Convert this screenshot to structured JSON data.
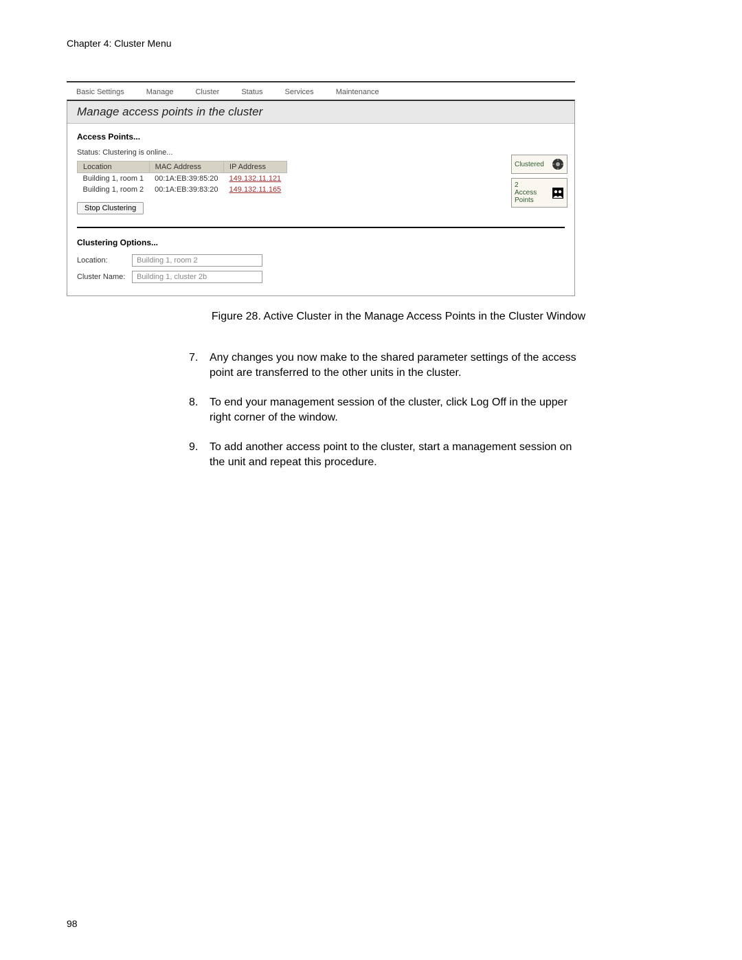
{
  "page_header": "Chapter 4: Cluster Menu",
  "tabs": {
    "basic_settings": "Basic Settings",
    "manage": "Manage",
    "cluster": "Cluster",
    "status": "Status",
    "services": "Services",
    "maintenance": "Maintenance"
  },
  "panel": {
    "title": "Manage access points in the cluster",
    "access_points_heading": "Access Points...",
    "status_text": "Status: Clustering is online...",
    "table": {
      "headers": {
        "location": "Location",
        "mac": "MAC Address",
        "ip": "IP Address"
      },
      "rows": [
        {
          "location": "Building 1, room 1",
          "mac": "00:1A:EB:39:85:20",
          "ip": "149.132.11.121"
        },
        {
          "location": "Building 1, room 2",
          "mac": "00:1A:EB:39:83:20",
          "ip": "149.132.11.165"
        }
      ]
    },
    "stop_button": "Stop Clustering",
    "clustering_options_heading": "Clustering Options...",
    "location_label": "Location:",
    "location_value": "Building 1, room 2",
    "cluster_name_label": "Cluster Name:",
    "cluster_name_value": "Building 1, cluster 2b",
    "side": {
      "clustered_label": "Clustered",
      "ap_count": "2",
      "ap_label_line1": "Access",
      "ap_label_line2": "Points"
    }
  },
  "figure_caption": "Figure 28. Active Cluster in the Manage Access Points in the Cluster Window",
  "instructions": [
    {
      "num": "7.",
      "text": "Any changes you now make to the shared parameter settings of the access point are transferred to the other units in the cluster."
    },
    {
      "num": "8.",
      "text": "To end your management session of the cluster, click Log Off in the upper right corner of the window."
    },
    {
      "num": "9.",
      "text": "To add another access point to the cluster, start a management session on the unit and repeat this procedure."
    }
  ],
  "page_number": "98"
}
